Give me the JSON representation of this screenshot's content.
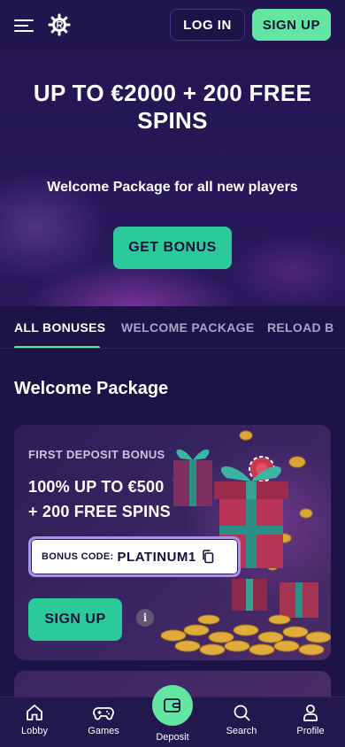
{
  "header": {
    "menu_icon": "hamburger-menu-icon",
    "logo_icon": "gear-logo-icon",
    "login_label": "LOG IN",
    "signup_label": "SIGN UP",
    "signup_color": "#63e6a2"
  },
  "hero": {
    "title": "UP TO €2000 + 200 FREE SPINS",
    "subtitle": "Welcome Package for all new players",
    "cta_label": "GET BONUS",
    "cta_color": "#2cc99a"
  },
  "tabs": [
    {
      "label": "ALL BONUSES",
      "active": true
    },
    {
      "label": "WELCOME PACKAGE",
      "active": false
    },
    {
      "label": "RELOAD B",
      "active": false
    }
  ],
  "section": {
    "title": "Welcome Package"
  },
  "bonus_card": {
    "label": "FIRST DEPOSIT BONUS",
    "title_line1": "100% UP TO €500",
    "title_line2": "+ 200 FREE SPINS",
    "code_label": "BONUS CODE:",
    "code_value": "PLATINUM1",
    "copy_icon": "copy-icon",
    "signup_label": "SIGN UP",
    "info_icon": "info-icon",
    "info_symbol": "i"
  },
  "bottom_nav": [
    {
      "label": "Lobby",
      "icon": "home-icon"
    },
    {
      "label": "Games",
      "icon": "gamepad-icon"
    },
    {
      "label": "Deposit",
      "icon": "wallet-icon"
    },
    {
      "label": "Search",
      "icon": "search-icon"
    },
    {
      "label": "Profile",
      "icon": "user-icon"
    }
  ],
  "colors": {
    "background": "#1e1346",
    "accent": "#63e6a2"
  }
}
